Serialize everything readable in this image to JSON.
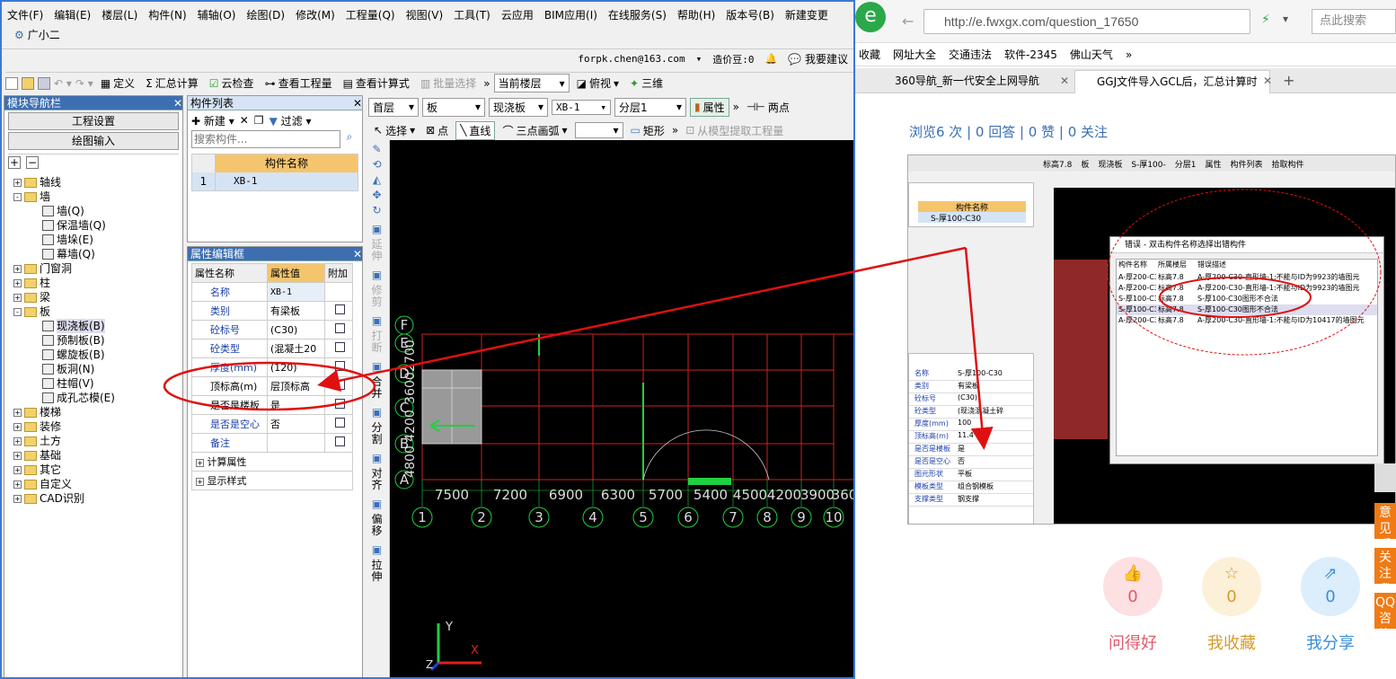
{
  "app": {
    "menus": [
      "文件(F)",
      "编辑(E)",
      "楼层(L)",
      "构件(N)",
      "辅轴(O)",
      "绘图(D)",
      "修改(M)",
      "工程量(Q)",
      "视图(V)",
      "工具(T)",
      "云应用",
      "BIM应用(I)",
      "在线服务(S)",
      "帮助(H)",
      "版本号(B)",
      "新建变更"
    ],
    "assistant": "广小二",
    "user_email": "forpk.chen@163.com",
    "cost_points": "造价豆:0",
    "suggest": "我要建议"
  },
  "toolbar1": {
    "define": "定义",
    "sum_calc": "汇总计算",
    "cloud_check": "云检查",
    "view_qty": "查看工程量",
    "view_formula": "查看计算式",
    "batch_select": "批量选择",
    "current_floor": "当前楼层",
    "plan_view": "俯视",
    "three_d": "三维"
  },
  "toolbar2": {
    "floor": "首层",
    "type": "板",
    "subtype": "现浇板",
    "component": "XB-1",
    "layer": "分层1",
    "property": "属性",
    "two_point": "两点"
  },
  "toolbar3": {
    "new": "新建",
    "filter": "过滤",
    "select": "选择",
    "point": "点",
    "line": "直线",
    "arc": "三点画弧",
    "rect": "矩形",
    "extract": "从模型提取工程量"
  },
  "nav": {
    "title": "模块导航栏",
    "project_settings": "工程设置",
    "drawing_input": "绘图输入",
    "tree": [
      {
        "label": "轴线",
        "level": 0,
        "sign": "+"
      },
      {
        "label": "墙",
        "level": 0,
        "sign": "-"
      },
      {
        "label": "墙(Q)",
        "level": 1
      },
      {
        "label": "保温墙(Q)",
        "level": 1
      },
      {
        "label": "墙垛(E)",
        "level": 1
      },
      {
        "label": "幕墙(Q)",
        "level": 1
      },
      {
        "label": "门窗洞",
        "level": 0,
        "sign": "+"
      },
      {
        "label": "柱",
        "level": 0,
        "sign": "+"
      },
      {
        "label": "梁",
        "level": 0,
        "sign": "+"
      },
      {
        "label": "板",
        "level": 0,
        "sign": "-"
      },
      {
        "label": "现浇板(B)",
        "level": 1
      },
      {
        "label": "预制板(B)",
        "level": 1
      },
      {
        "label": "螺旋板(B)",
        "level": 1
      },
      {
        "label": "板洞(N)",
        "level": 1
      },
      {
        "label": "柱帽(V)",
        "level": 1
      },
      {
        "label": "成孔芯模(E)",
        "level": 1
      },
      {
        "label": "楼梯",
        "level": 0,
        "sign": "+"
      },
      {
        "label": "装修",
        "level": 0,
        "sign": "+"
      },
      {
        "label": "土方",
        "level": 0,
        "sign": "+"
      },
      {
        "label": "基础",
        "level": 0,
        "sign": "+"
      },
      {
        "label": "其它",
        "level": 0,
        "sign": "+"
      },
      {
        "label": "自定义",
        "level": 0,
        "sign": "+"
      },
      {
        "label": "CAD识别",
        "level": 0,
        "sign": "+"
      }
    ]
  },
  "component_list": {
    "title": "构件列表",
    "search_placeholder": "搜索构件...",
    "header": "构件名称",
    "rows": [
      {
        "index": "1",
        "name": "XB-1"
      }
    ]
  },
  "props": {
    "title": "属性编辑框",
    "headers": [
      "属性名称",
      "属性值",
      "附加"
    ],
    "rows": [
      {
        "name": "名称",
        "value": "XB-1",
        "blue": true,
        "check": false
      },
      {
        "name": "类别",
        "value": "有梁板",
        "blue": true,
        "check": true
      },
      {
        "name": "砼标号",
        "value": "(C30)",
        "blue": true,
        "check": true
      },
      {
        "name": "砼类型",
        "value": "(混凝土20",
        "blue": true,
        "check": true
      },
      {
        "name": "厚度(mm)",
        "value": "(120)",
        "blue": true,
        "check": true
      },
      {
        "name": "顶标高(m)",
        "value": "层顶标高",
        "blue": false,
        "check": true
      },
      {
        "name": "是否是楼板",
        "value": "是",
        "blue": false,
        "check": true
      },
      {
        "name": "是否是空心",
        "value": "否",
        "blue": true,
        "check": true
      },
      {
        "name": "备注",
        "value": "",
        "blue": true,
        "check": true
      }
    ],
    "groups": [
      "计算属性",
      "显示样式"
    ]
  },
  "vertical_tools": [
    "延伸",
    "修剪",
    "打断",
    "合并",
    "分割",
    "对齐",
    "偏移",
    "拉伸"
  ],
  "canvas": {
    "x_dims": [
      "7500",
      "7200",
      "6900",
      "6300",
      "5700",
      "5400",
      "4500",
      "4200",
      "3900",
      "360"
    ],
    "x_axes": [
      "1",
      "2",
      "3",
      "4",
      "5",
      "6",
      "7",
      "8",
      "9",
      "10"
    ],
    "y_axes": [
      "A",
      "B",
      "C",
      "D",
      "E",
      "F"
    ],
    "y_dims": [
      "4800",
      "4200",
      "3600",
      "2700"
    ],
    "axis_y": "Y",
    "axis_x": "X",
    "axis_z": "Z"
  },
  "browser": {
    "url": "http://e.fwxgx.com/question_17650",
    "search": "点此搜索",
    "favorites": [
      "收藏",
      "网址大全",
      "交通违法",
      "软件-2345",
      "佛山天气"
    ],
    "tabs": [
      "360导航_新一代安全上网导航",
      "GGJ文件导入GCL后，汇总计算时"
    ],
    "stats": "浏览6 次 | 0 回答 | 0 赞 | 0 关注",
    "actions": [
      {
        "count": "0",
        "label": "问得好",
        "color": "#e05a6a",
        "bg": "#fde0e2"
      },
      {
        "count": "0",
        "label": "我收藏",
        "color": "#d69a2c",
        "bg": "#fdf0d8"
      },
      {
        "count": "0",
        "label": "我分享",
        "color": "#3a8ed8",
        "bg": "#dcedfb"
      }
    ],
    "float_tabs": [
      "意见反馈",
      "关注我们",
      "QQ咨询"
    ]
  },
  "embedded": {
    "dialog_title": "错误 - 双击构件名称选择出错构件",
    "dialog_headers": [
      "构件名称",
      "所属楼层",
      "错误描述"
    ],
    "dialog_rows": [
      [
        "A-厚200-C30",
        "标高7.8",
        "A-厚200-C30-直形墙-1:不能与ID为9923的墙图元"
      ],
      [
        "A-厚200-C30",
        "标高7.8",
        "A-厚200-C30-直形墙-1:不能与ID为9923的墙图元"
      ],
      [
        "S-厚100-C30",
        "标高7.8",
        "S-厚100-C30图形不合法"
      ],
      [
        "S-厚100-C30",
        "标高7.8",
        "S-厚100-C30图形不合法"
      ],
      [
        "A-厚200-C30",
        "标高7.8",
        "A-厚200-C30-直形墙-1:不能与ID为10417的墙图元"
      ]
    ],
    "comp_header": "构件名称",
    "comp_row": "S-厚100-C30",
    "prop_rows": [
      [
        "名称",
        "S-厚100-C30"
      ],
      [
        "类别",
        "有梁板"
      ],
      [
        "砼标号",
        "(C30)"
      ],
      [
        "砼类型",
        "(现浇混凝土碎"
      ],
      [
        "厚度(mm)",
        "100"
      ],
      [
        "顶标高(m)",
        "11.4"
      ],
      [
        "是否是楼板",
        "是"
      ],
      [
        "是否是空心",
        "否"
      ],
      [
        "图元形状",
        "平板"
      ],
      [
        "模板类型",
        "组合钢模板"
      ],
      [
        "支撑类型",
        "钢支撑"
      ]
    ],
    "toolbar_items": [
      "标高7.8",
      "板",
      "现浇板",
      "S-厚100-",
      "分层1",
      "属性",
      "构件列表",
      "拾取构件"
    ]
  }
}
